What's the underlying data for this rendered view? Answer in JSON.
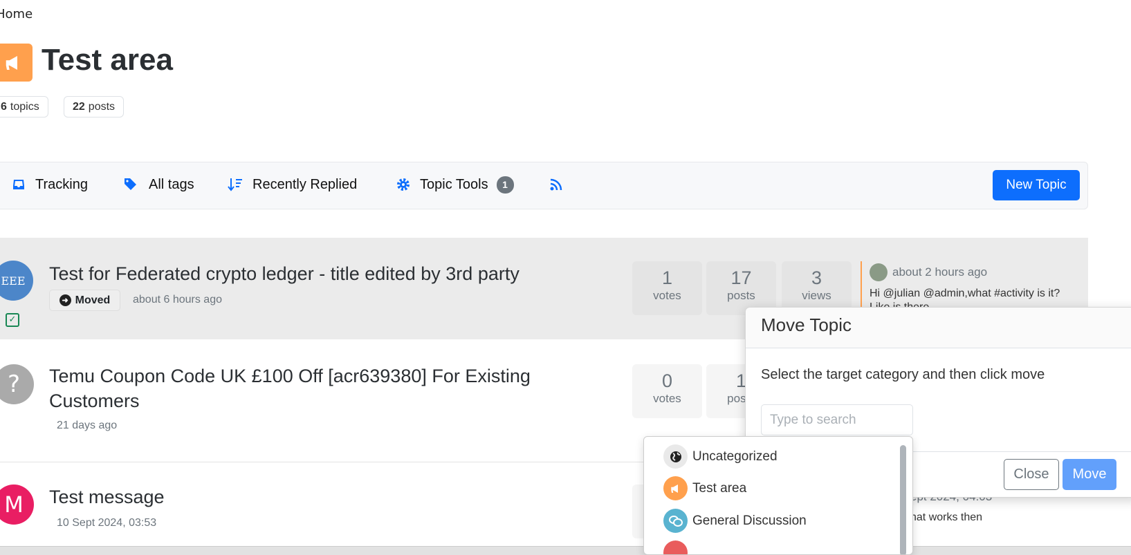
{
  "breadcrumb": {
    "home": "Home"
  },
  "category": {
    "title": "Test area",
    "icon": "bullhorn-icon",
    "color": "#ffa04d",
    "topics_count": "6",
    "topics_label": "topics",
    "posts_count": "22",
    "posts_label": "posts"
  },
  "toolbar": {
    "tracking": "Tracking",
    "all_tags": "All tags",
    "sort": "Recently Replied",
    "topic_tools": "Topic Tools",
    "topic_tools_count": "1",
    "new_topic": "New Topic",
    "accent": "#0d6efd"
  },
  "topics": [
    {
      "title": "Test for Federated crypto ledger - title edited by 3rd party",
      "badge": "Moved",
      "time": "about 6 hours ago",
      "votes": "1",
      "votes_label": "votes",
      "posts": "17",
      "posts_label": "posts",
      "views": "3",
      "views_label": "views",
      "teaser_time": "about 2 hours ago",
      "teaser_text": "Hi @julian @admin,what #activity is it?",
      "teaser_text2": "Like is there",
      "selected": true
    },
    {
      "title": "Temu Coupon Code UK £100 Off [acr639380] For Existing Customers",
      "avatar": "?",
      "time": "21 days ago",
      "votes": "0",
      "votes_label": "votes",
      "posts": "1",
      "posts_label": "posts"
    },
    {
      "title": "Test message",
      "avatar": "M",
      "time": "10 Sept 2024, 03:53",
      "teaser_time": "ept 2024, 04:03",
      "teaser_text": "hat works then"
    }
  ],
  "modal": {
    "title": "Move Topic",
    "instruction": "Select the target category and then click move",
    "search_placeholder": "Type to search",
    "close": "Close",
    "move": "Move"
  },
  "category_options": [
    {
      "label": "Uncategorized",
      "icon": "globe-icon",
      "color": "#e9e9e9"
    },
    {
      "label": "Test area",
      "icon": "bullhorn-icon",
      "color": "#ffa04d"
    },
    {
      "label": "General Discussion",
      "icon": "comments-icon",
      "color": "#59b3d0"
    },
    {
      "label": "",
      "icon": "category-icon",
      "color": "#e95c5c"
    }
  ]
}
